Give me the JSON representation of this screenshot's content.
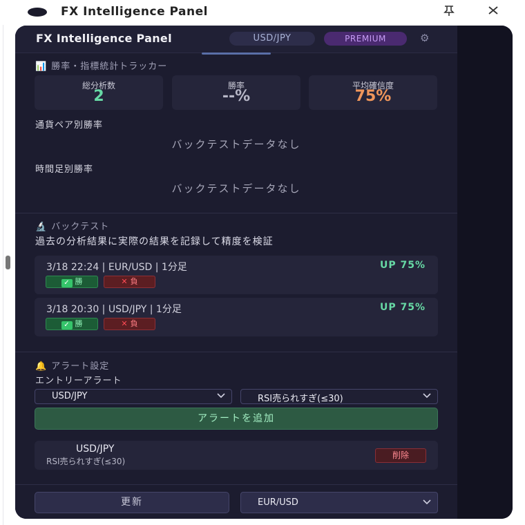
{
  "window": {
    "title": "FX Intelligence Panel",
    "pin_icon": "pin-icon",
    "close_icon": "close-icon"
  },
  "header": {
    "title": "FX Intelligence Panel",
    "pair_badge": "USD/JPY",
    "plan_badge": "PREMIUM",
    "gear_icon": "⚙"
  },
  "tracker": {
    "icon": "📊",
    "title": "勝率・指標統計トラッカー",
    "stats": [
      {
        "label": "総分析数",
        "value": "2",
        "color": "#67d9a5"
      },
      {
        "label": "勝率",
        "value": "--%",
        "color": "#b7b7c7"
      },
      {
        "label": "平均確信度",
        "value": "75%",
        "color": "#f0965b"
      }
    ],
    "pair_winrate_label": "通貨ペア別勝率",
    "pair_winrate_empty": "バックテストデータなし",
    "tf_winrate_label": "時間足別勝率",
    "tf_winrate_empty": "バックテストデータなし"
  },
  "backtest": {
    "icon": "🔬",
    "title": "バックテスト",
    "description": "過去の分析結果に実際の結果を記録して精度を検証",
    "entries": [
      {
        "meta": "3/18 22:24 | EUR/USD | 1分足",
        "result": "UP 75%",
        "win_label": "勝",
        "lose_label": "負"
      },
      {
        "meta": "3/18 20:30 | USD/JPY | 1分足",
        "result": "UP 75%",
        "win_label": "勝",
        "lose_label": "負"
      }
    ]
  },
  "alerts": {
    "icon": "🔔",
    "title": "アラート設定",
    "entry_label": "エントリーアラート",
    "pair_select": "USD/JPY",
    "condition_select": "RSI売られすぎ(≤30)",
    "add_button": "アラートを追加",
    "items": [
      {
        "pair": "USD/JPY",
        "condition": "RSI売られすぎ(≤30)",
        "delete_label": "削除"
      }
    ]
  },
  "footer": {
    "refresh_button": "更新",
    "pair_select": "EUR/USD"
  }
}
